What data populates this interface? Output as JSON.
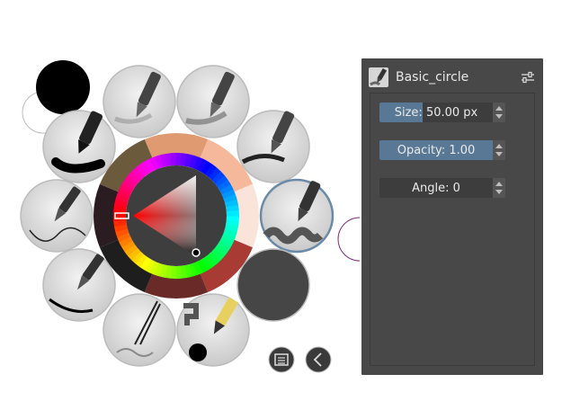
{
  "panel": {
    "preset_name": "Basic_circle",
    "size_label": "Size:",
    "size_value": "50.00 px",
    "size_fraction": 0.38,
    "opacity_label": "Opacity:",
    "opacity_value": "1.00",
    "opacity_fraction": 1.0,
    "angle_label": "Angle:",
    "angle_value": "0",
    "angle_fraction": 0.0
  },
  "colors": {
    "foreground": "#000000",
    "background": "#ffffff",
    "panel_bg": "#484848",
    "accent": "#587896",
    "history_ring": [
      "#e09a72",
      "#f5b89a",
      "#fae3d8",
      "#a83c34",
      "#6a2a28",
      "#1e1e1e",
      "#2a1c20",
      "#6b5a3c"
    ]
  },
  "icons": [
    "tune-icon",
    "brush-preset-icon",
    "tag-list-icon",
    "chevron-left-icon"
  ]
}
